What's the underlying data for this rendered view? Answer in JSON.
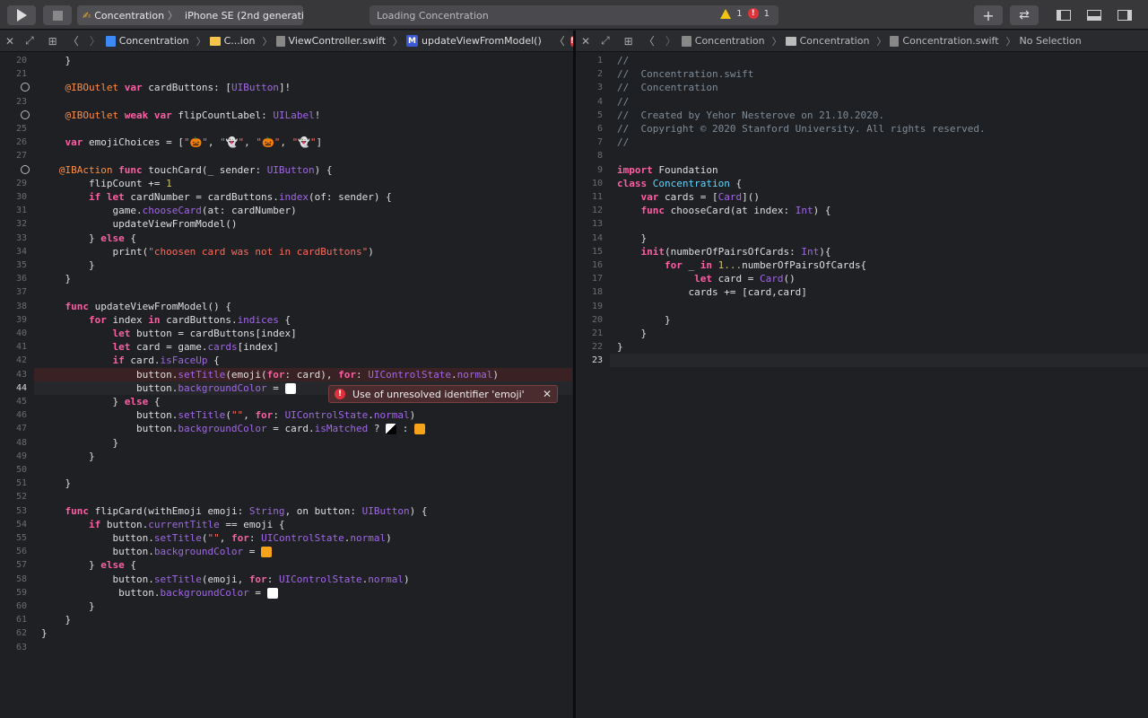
{
  "toolbar": {
    "scheme": {
      "project": "Concentration",
      "device": "iPhone SE (2nd generation)"
    },
    "status": {
      "text": "Loading Concentration",
      "warnings": "1",
      "errors": "1"
    }
  },
  "left_jumpbar": {
    "crumbs": [
      "Concentration",
      "C...ion",
      "ViewController.swift",
      "updateViewFromModel()"
    ],
    "error_count": "!"
  },
  "right_jumpbar": {
    "crumbs": [
      "Concentration",
      "Concentration",
      "Concentration.swift",
      "No Selection"
    ],
    "error_count": "!"
  },
  "popup": {
    "message": "Use of unresolved identifier 'emoji'"
  },
  "left_lines": [
    {
      "n": "20",
      "t": "    }"
    },
    {
      "n": "21",
      "t": ""
    },
    {
      "n": "",
      "t": "    @IBOutlet var cardButtons: [UIButton]!"
    },
    {
      "n": "23",
      "t": ""
    },
    {
      "n": "",
      "t": "    @IBOutlet weak var flipCountLabel: UILabel!"
    },
    {
      "n": "25",
      "t": ""
    },
    {
      "n": "26",
      "t": "    var emojiChoices = [\"🎃\", \"👻\", \"🎃\", \"👻\"]"
    },
    {
      "n": "27",
      "t": ""
    },
    {
      "n": "",
      "t": "   @IBAction func touchCard(_ sender: UIButton) {"
    },
    {
      "n": "29",
      "t": "        flipCount += 1"
    },
    {
      "n": "30",
      "t": "        if let cardNumber = cardButtons.index(of: sender) {"
    },
    {
      "n": "31",
      "t": "            game.chooseCard(at: cardNumber)"
    },
    {
      "n": "32",
      "t": "            updateViewFromModel()"
    },
    {
      "n": "33",
      "t": "        } else {"
    },
    {
      "n": "34",
      "t": "            print(\"choosen card was not in cardButtons\")"
    },
    {
      "n": "35",
      "t": "        }"
    },
    {
      "n": "36",
      "t": "    }"
    },
    {
      "n": "37",
      "t": ""
    },
    {
      "n": "38",
      "t": "    func updateViewFromModel() {"
    },
    {
      "n": "39",
      "t": "        for index in cardButtons.indices {"
    },
    {
      "n": "40",
      "t": "            let button = cardButtons[index]"
    },
    {
      "n": "41",
      "t": "            let card = game.cards[index]"
    },
    {
      "n": "42",
      "t": "            if card.isFaceUp {"
    },
    {
      "n": "43",
      "t": "                button.setTitle(emoji(for: card), for: UIControlState.normal)"
    },
    {
      "n": "44",
      "t": "                button.backgroundColor = "
    },
    {
      "n": "45",
      "t": "            } else {"
    },
    {
      "n": "46",
      "t": "                button.setTitle(\"\", for: UIControlState.normal)"
    },
    {
      "n": "47",
      "t": "                button.backgroundColor = card.isMatched ? "
    },
    {
      "n": "48",
      "t": "            }"
    },
    {
      "n": "49",
      "t": "        }"
    },
    {
      "n": "50",
      "t": ""
    },
    {
      "n": "51",
      "t": "    }"
    },
    {
      "n": "52",
      "t": ""
    },
    {
      "n": "53",
      "t": "    func flipCard(withEmoji emoji: String, on button: UIButton) {"
    },
    {
      "n": "54",
      "t": "        if button.currentTitle == emoji {"
    },
    {
      "n": "55",
      "t": "            button.setTitle(\"\", for: UIControlState.normal)"
    },
    {
      "n": "56",
      "t": "            button.backgroundColor = "
    },
    {
      "n": "57",
      "t": "        } else {"
    },
    {
      "n": "58",
      "t": "            button.setTitle(emoji, for: UIControlState.normal)"
    },
    {
      "n": "59",
      "t": "             button.backgroundColor = "
    },
    {
      "n": "60",
      "t": "        }"
    },
    {
      "n": "61",
      "t": "    }"
    },
    {
      "n": "62",
      "t": "}"
    },
    {
      "n": "63",
      "t": ""
    }
  ],
  "right_lines": [
    {
      "n": "1",
      "t": "//"
    },
    {
      "n": "2",
      "t": "//  Concentration.swift"
    },
    {
      "n": "3",
      "t": "//  Concentration"
    },
    {
      "n": "4",
      "t": "//"
    },
    {
      "n": "5",
      "t": "//  Created by Yehor Nesterove on 21.10.2020."
    },
    {
      "n": "6",
      "t": "//  Copyright © 2020 Stanford University. All rights reserved."
    },
    {
      "n": "7",
      "t": "//"
    },
    {
      "n": "8",
      "t": ""
    },
    {
      "n": "9",
      "t": "import Foundation"
    },
    {
      "n": "10",
      "t": "class Concentration {"
    },
    {
      "n": "11",
      "t": "    var cards = [Card]()"
    },
    {
      "n": "12",
      "t": "    func chooseCard(at index: Int) {"
    },
    {
      "n": "13",
      "t": ""
    },
    {
      "n": "14",
      "t": "    }"
    },
    {
      "n": "15",
      "t": "    init(numberOfPairsOfCards: Int){"
    },
    {
      "n": "16",
      "t": "        for _ in 1...numberOfPairsOfCards{"
    },
    {
      "n": "17",
      "t": "             let card = Card()"
    },
    {
      "n": "18",
      "t": "            cards += [card,card]"
    },
    {
      "n": "19",
      "t": ""
    },
    {
      "n": "20",
      "t": "        }"
    },
    {
      "n": "21",
      "t": "    }"
    },
    {
      "n": "22",
      "t": "}"
    },
    {
      "n": "23",
      "t": ""
    }
  ],
  "colors": {
    "orange": "#f7a21b",
    "white": "#ffffff"
  },
  "icons": [
    "run-icon",
    "stop-icon",
    "warning-icon",
    "error-icon",
    "add-icon",
    "swap-icon",
    "navigator-icon",
    "debug-area-icon",
    "inspector-icon",
    "close-icon",
    "expand-icon",
    "grid-icon",
    "chevron-left-icon",
    "chevron-right-icon",
    "swift-file-icon",
    "folder-icon",
    "method-icon",
    "lines-icon",
    "split-icon"
  ]
}
